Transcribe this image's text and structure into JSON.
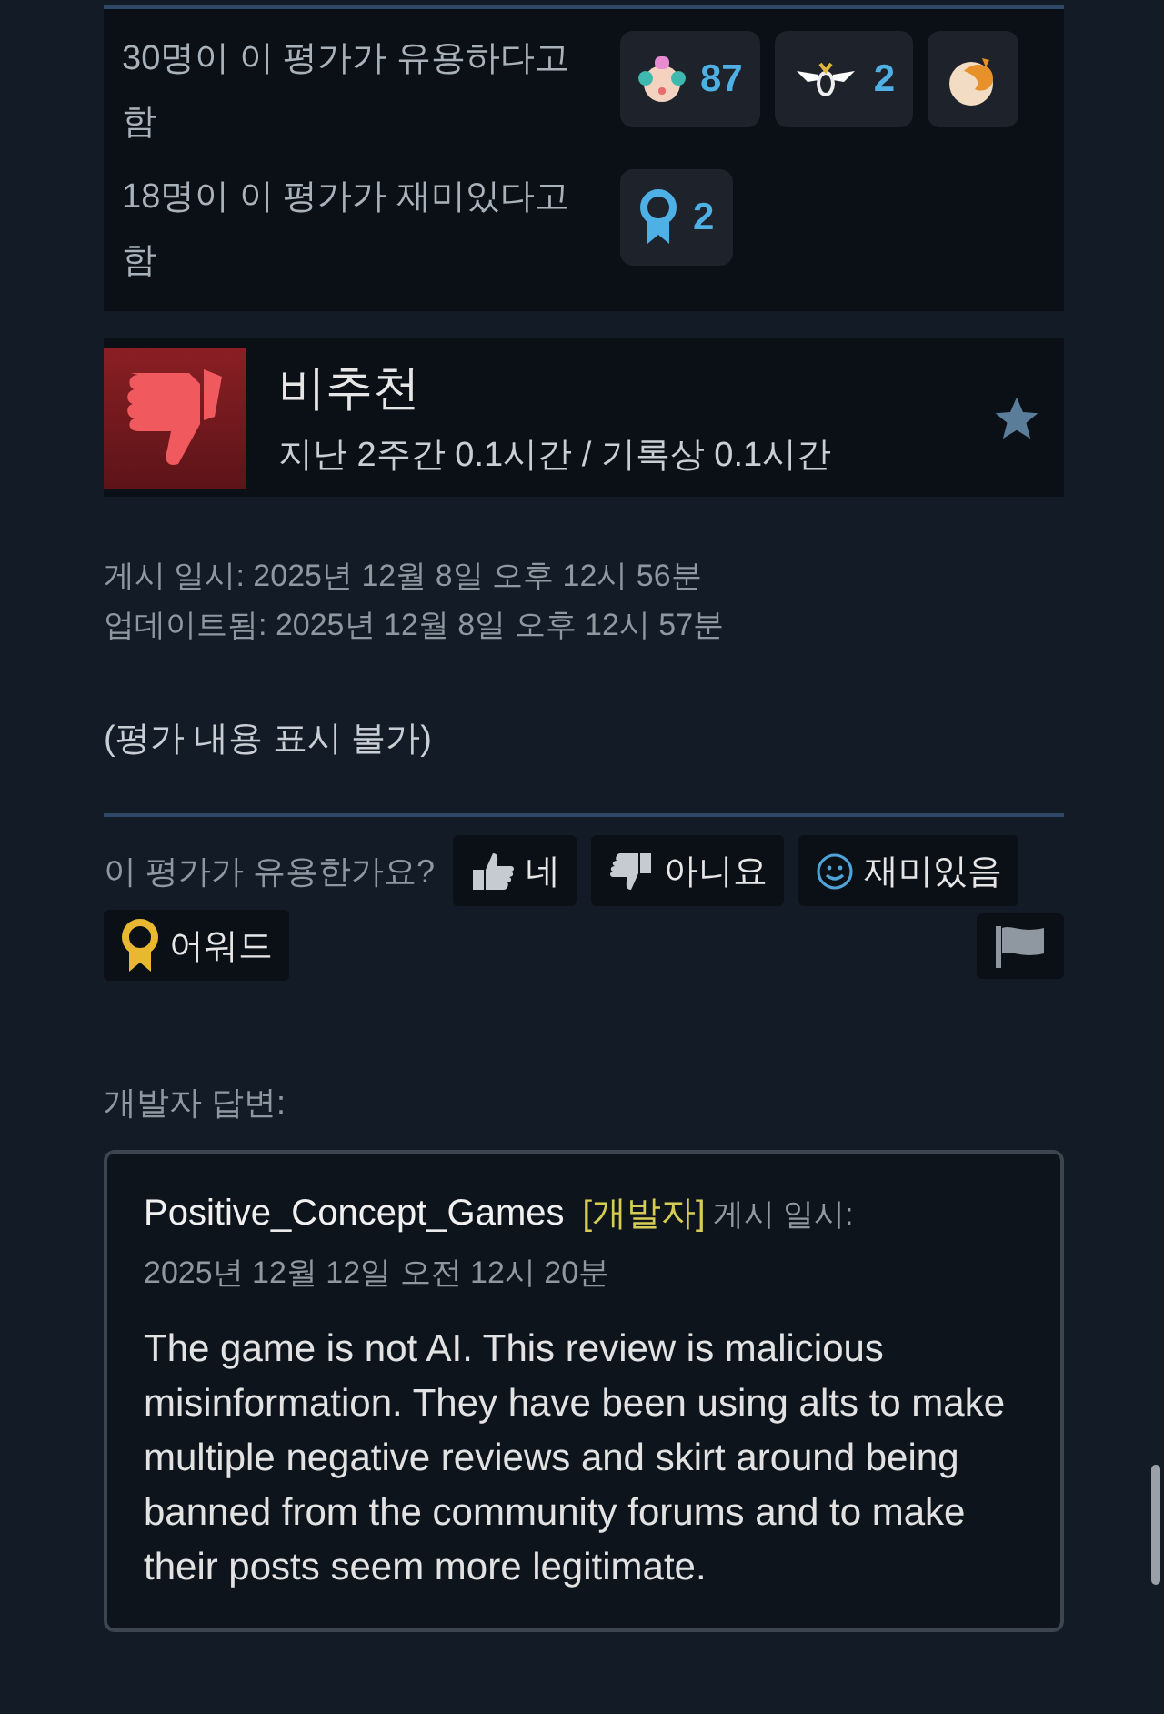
{
  "votes": [
    {
      "text": "30명이 이 평가가 유용하다고 함",
      "awards": [
        {
          "kind": "face",
          "count": "87"
        },
        {
          "kind": "wings",
          "count": "2"
        },
        {
          "kind": "dragon"
        }
      ]
    },
    {
      "text": "18명이 이 평가가 재미있다고 함",
      "awards": [
        {
          "kind": "ribbon",
          "count": "2"
        }
      ]
    }
  ],
  "verdict": {
    "kind": "negative",
    "title": "비추천",
    "hours": "지난 2주간 0.1시간 / 기록상 0.1시간"
  },
  "posted": "게시 일시: 2025년 12월 8일 오후 12시 56분",
  "updated": "업데이트됨: 2025년 12월 8일 오후 12시 57분",
  "content": "(평가 내용 표시 불가)",
  "feedback": {
    "question": "이 평가가 유용한가요?",
    "buttons": [
      {
        "kind": "up",
        "label": "네"
      },
      {
        "kind": "down",
        "label": "아니요"
      },
      {
        "kind": "funny",
        "label": "재미있음"
      },
      {
        "kind": "award",
        "label": "어워드"
      }
    ]
  },
  "developer_response": {
    "heading": "개발자 답변:",
    "author": "Positive_Concept_Games",
    "badge": "[개발자]",
    "posted_label": "게시 일시:",
    "date": "2025년 12월 12일 오전 12시 20분",
    "body": "The game is not AI. This review is malicious misinformation. They have been using alts to make multiple negative reviews and skirt around being banned from the community forums and to make their posts seem more legitimate."
  }
}
